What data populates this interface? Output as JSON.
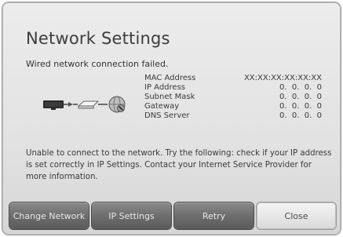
{
  "dialog": {
    "title": "Network Settings",
    "status": "Wired network connection failed.",
    "info": [
      {
        "label": "MAC Address",
        "value": "XX:XX:XX:XX:XX:XX"
      },
      {
        "label": "IP Address",
        "value": "0.  0.  0.  0"
      },
      {
        "label": "Subnet Mask",
        "value": "0.  0.  0.  0"
      },
      {
        "label": "Gateway",
        "value": "0.  0.  0.  0"
      },
      {
        "label": "DNS Server",
        "value": "0.  0.  0.  0"
      }
    ],
    "message": "Unable to connect to the network. Try the following: check if your IP address is set correctly in IP Settings. Contact your Internet Service Provider for more information.",
    "buttons": {
      "change_network": "Change Network",
      "ip_settings": "IP Settings",
      "retry": "Retry",
      "close": "Close"
    }
  },
  "colors": {
    "button_dark": "#6e6e6e",
    "button_selected": "#e6e6e6",
    "dialog_bg": "#e4e4e4"
  },
  "icons": [
    "tv-icon",
    "plug-icon",
    "router-icon",
    "globe-icon"
  ]
}
